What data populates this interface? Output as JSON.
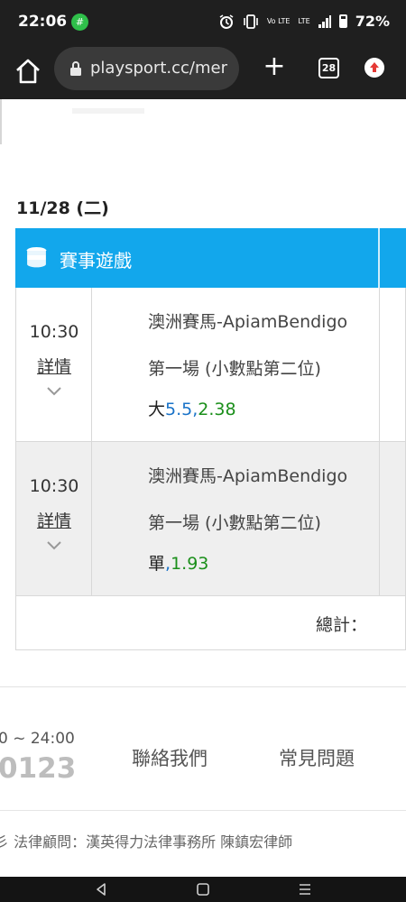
{
  "status_bar": {
    "time": "22:06",
    "notification_badge": "#",
    "volte_label": "Vo LTE",
    "lte_label": "LTE",
    "battery_percent": "72%",
    "icons": [
      "alarm-icon",
      "vibrate-icon",
      "volte-icon",
      "lte-icon",
      "signal-icon",
      "battery-icon"
    ]
  },
  "browser": {
    "url": "playsport.cc/mer",
    "tab_count": "28",
    "icons": [
      "home-icon",
      "lock-icon",
      "new-tab-icon",
      "tab-switcher-icon",
      "update-icon"
    ]
  },
  "page": {
    "date": "11/28 (二)",
    "table_title": "賽事遊戲",
    "rows": [
      {
        "time": "10:30",
        "detail_link": "詳情",
        "event": "澳洲賽馬-ApiamBendigo",
        "event_line2": "第一場 (小數點第二位)",
        "pick_selection": "大",
        "pick_line": "5.5",
        "pick_sep": ",",
        "pick_odds": "2.38"
      },
      {
        "time": "10:30",
        "detail_link": "詳情",
        "event": "澳洲賽馬-ApiamBendigo",
        "event_line2": "第一場 (小數點第二位)",
        "pick_selection": "單",
        "pick_line": "",
        "pick_sep": ",",
        "pick_odds": "1.93"
      }
    ],
    "total_label": "總計："
  },
  "footer": {
    "hours": "0 ~ 24:00",
    "phone": "0123",
    "contact_us": "聯絡我們",
    "faq": "常見問題",
    "legal": "彡 法律顧問：漢英得力法律事務所 陳鎮宏律師"
  },
  "colors": {
    "header_blue": "#12a7ec",
    "odds_green": "#1b8f1b",
    "line_blue": "#1a73c8",
    "status_green": "#2fbf4a"
  }
}
